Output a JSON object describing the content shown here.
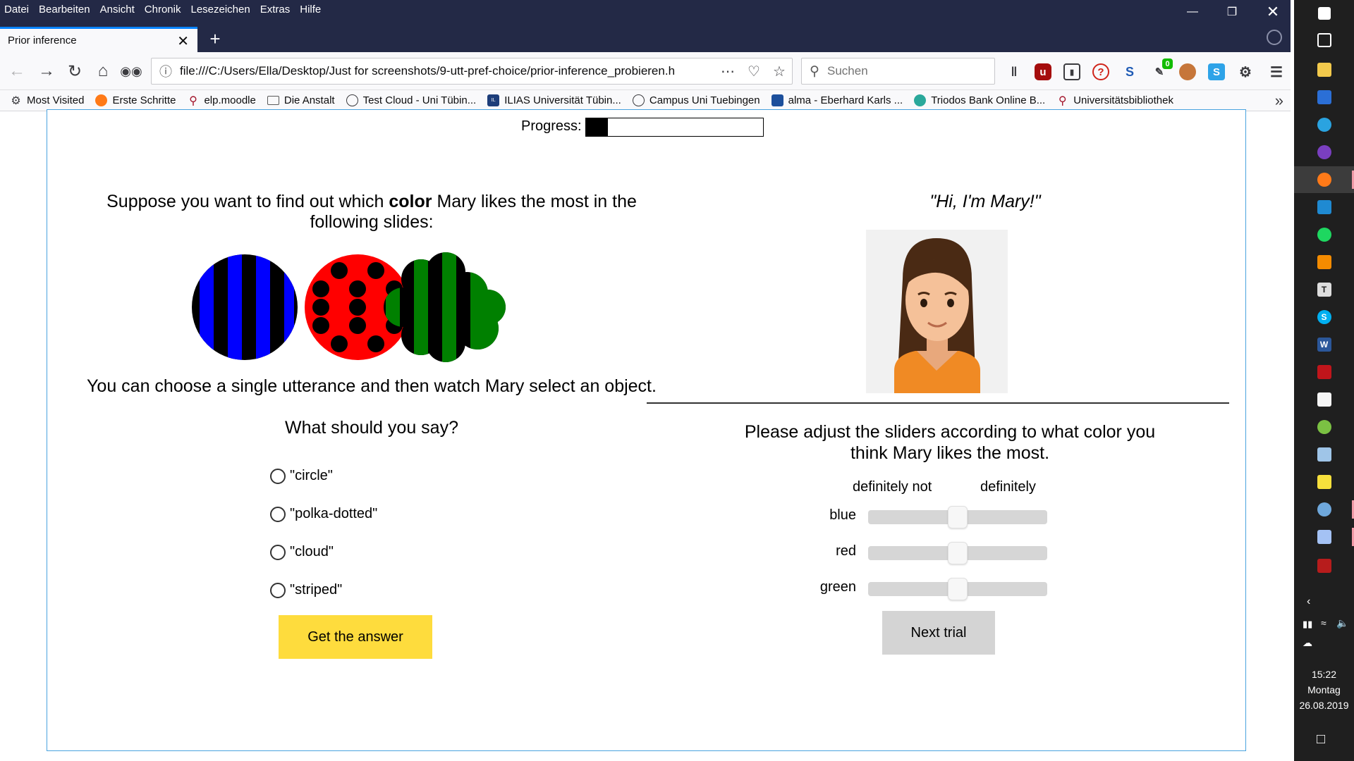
{
  "menubar": {
    "items": [
      "Datei",
      "Bearbeiten",
      "Ansicht",
      "Chronik",
      "Lesezeichen",
      "Extras",
      "Hilfe"
    ]
  },
  "window_controls": [
    "minimize-icon",
    "restore-icon",
    "close-icon"
  ],
  "tab": {
    "title": "Prior inference"
  },
  "navbar": {
    "url": "file:///C:/Users/Ella/Desktop/Just for screenshots/9-utt-pref-choice/prior-inference_probieren.h",
    "search_placeholder": "Suchen",
    "badge_count": "0"
  },
  "bookmarks": [
    {
      "label": "Most Visited",
      "icon": "gear-icon"
    },
    {
      "label": "Erste Schritte",
      "icon": "firefox-icon"
    },
    {
      "label": "elp.moodle",
      "icon": "pin-icon"
    },
    {
      "label": "Die Anstalt",
      "icon": "folder-icon"
    },
    {
      "label": "Test Cloud - Uni Tübin...",
      "icon": "globe-icon"
    },
    {
      "label": "ILIAS Universität Tübin...",
      "icon": "ilias-icon"
    },
    {
      "label": "Campus Uni Tuebingen",
      "icon": "globe-icon"
    },
    {
      "label": "alma - Eberhard Karls ...",
      "icon": "alma-icon"
    },
    {
      "label": "Triodos Bank Online B...",
      "icon": "bank-icon"
    },
    {
      "label": "Universitätsbibliothek",
      "icon": "pin-icon"
    }
  ],
  "page": {
    "progress_label": "Progress:",
    "progress_fraction": 0.125,
    "intro_pre": "Suppose you want to find out which ",
    "intro_bold": "color",
    "intro_post": " Mary likes the most in the following slides:",
    "objects": [
      {
        "name": "blue-striped-circle",
        "colors": [
          "#0000ff",
          "#000000"
        ]
      },
      {
        "name": "red-polka-dotted-circle",
        "colors": [
          "#ff0000",
          "#000000"
        ]
      },
      {
        "name": "green-striped-cloud",
        "colors": [
          "#008000",
          "#000000"
        ]
      }
    ],
    "choose_text": "You can choose a single utterance and then watch Mary select an object.",
    "question": "What should you say?",
    "options": [
      "\"circle\"",
      "\"polka-dotted\"",
      "\"cloud\"",
      "\"striped\""
    ],
    "answer_button": "Get the answer",
    "mary_quote": "\"Hi, I'm Mary!\"",
    "sliders_prompt": "Please adjust the sliders according to what color you think Mary likes the most.",
    "scale_low": "definitely not",
    "scale_high": "definitely",
    "sliders": [
      {
        "label": "blue",
        "value": 0.5
      },
      {
        "label": "red",
        "value": 0.5
      },
      {
        "label": "green",
        "value": 0.5
      }
    ],
    "next_button": "Next trial"
  },
  "taskbar": {
    "time": "15:22",
    "day": "Montag",
    "date": "26.08.2019"
  }
}
